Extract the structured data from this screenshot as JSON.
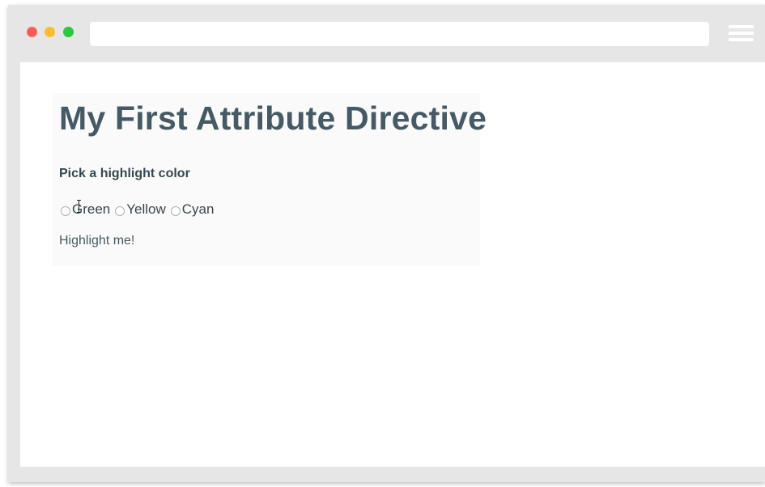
{
  "browser": {
    "address_bar_text": "",
    "window_controls": [
      "close",
      "minimize",
      "maximize"
    ],
    "colors": {
      "close": "#ff5f57",
      "minimize": "#febc2e",
      "maximize": "#28c840",
      "frame": "#e6e6e6"
    },
    "menu_icon": "hamburger-menu-icon"
  },
  "page": {
    "title": "My First Attribute Directive",
    "prompt": "Pick a highlight color",
    "radio_options": [
      {
        "label": "Green",
        "checked": false
      },
      {
        "label": "Yellow",
        "checked": false
      },
      {
        "label": "Cyan",
        "checked": false
      }
    ],
    "highlight_text": "Highlight me!",
    "text_color": "#455a64"
  }
}
